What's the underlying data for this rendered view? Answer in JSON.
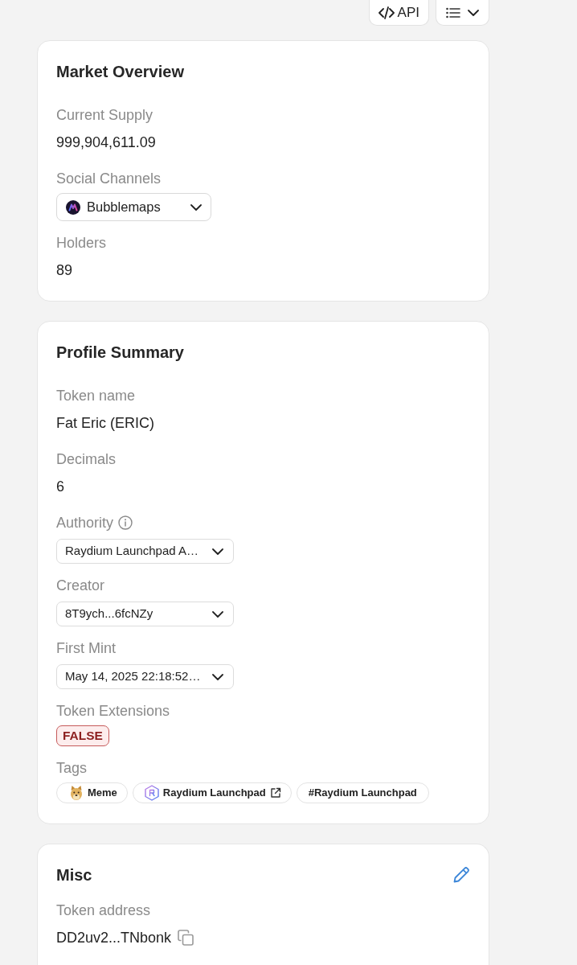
{
  "toolbar": [
    {
      "kind": "api",
      "label": "API"
    },
    {
      "kind": "menu"
    }
  ],
  "cards": [
    {
      "title": "Market Overview",
      "editable": false,
      "fields": [
        {
          "kind": "text",
          "label": "Current Supply",
          "info_icon": false,
          "value": "999,904,611.09"
        },
        {
          "kind": "channel",
          "label": "Social Channels",
          "info_icon": false,
          "value": "Bubblemaps"
        },
        {
          "kind": "text",
          "label": "Holders",
          "info_icon": false,
          "value": "89"
        }
      ]
    },
    {
      "title": "Profile Summary",
      "editable": false,
      "fields": [
        {
          "kind": "text",
          "label": "Token name",
          "info_icon": false,
          "value": "Fat Eric (ERIC)"
        },
        {
          "kind": "text",
          "label": "Decimals",
          "info_icon": false,
          "value": "6"
        },
        {
          "kind": "select",
          "label": "Authority",
          "info_icon": true,
          "value": "Raydium Launchpad A…"
        },
        {
          "kind": "select",
          "label": "Creator",
          "info_icon": false,
          "value": "8T9ych...6fcNZy"
        },
        {
          "kind": "select",
          "label": "First Mint",
          "info_icon": false,
          "value": "May 14, 2025 22:18:52…"
        },
        {
          "kind": "badge",
          "label": "Token Extensions",
          "info_icon": false,
          "value": "FALSE",
          "negative": true
        },
        {
          "kind": "tags",
          "label": "Tags",
          "info_icon": false,
          "tags": [
            {
              "kind": "meme",
              "label": "Meme"
            },
            {
              "kind": "launchpad",
              "label": "Raydium Launchpad"
            },
            {
              "kind": "hashtag",
              "label": "#Raydium Launchpad"
            }
          ]
        }
      ]
    },
    {
      "title": "Misc",
      "editable": true,
      "fields": [
        {
          "kind": "copy",
          "label": "Token address",
          "info_icon": false,
          "value": "DD2uv2...TNbonk"
        }
      ]
    }
  ]
}
